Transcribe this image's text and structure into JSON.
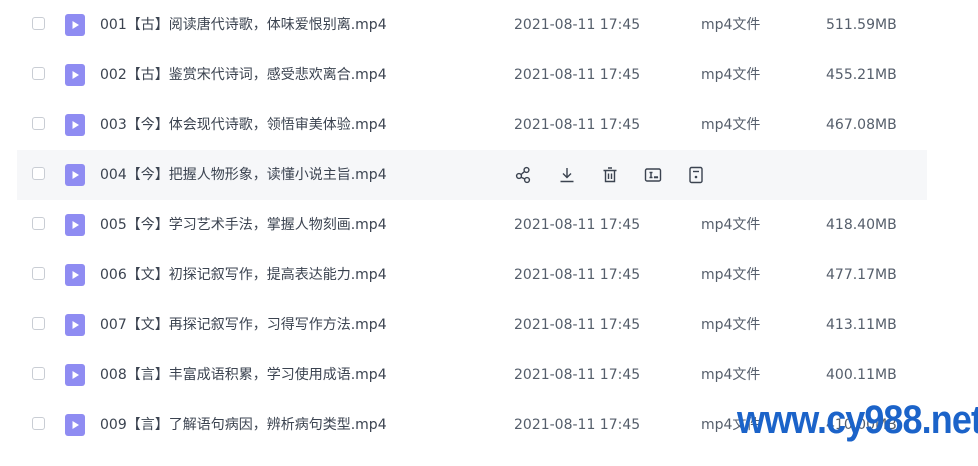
{
  "files": [
    {
      "name": "001【古】阅读唐代诗歌，体味爱恨别离.mp4",
      "date": "2021-08-11 17:45",
      "type": "mp4文件",
      "size": "511.59MB"
    },
    {
      "name": "002【古】鉴赏宋代诗词，感受悲欢离合.mp4",
      "date": "2021-08-11 17:45",
      "type": "mp4文件",
      "size": "455.21MB"
    },
    {
      "name": "003【今】体会现代诗歌，领悟审美体验.mp4",
      "date": "2021-08-11 17:45",
      "type": "mp4文件",
      "size": "467.08MB"
    },
    {
      "name": "004【今】把握人物形象，读懂小说主旨.mp4"
    },
    {
      "name": "005【今】学习艺术手法，掌握人物刻画.mp4",
      "date": "2021-08-11 17:45",
      "type": "mp4文件",
      "size": "418.40MB"
    },
    {
      "name": "006【文】初探记叙写作，提高表达能力.mp4",
      "date": "2021-08-11 17:45",
      "type": "mp4文件",
      "size": "477.17MB"
    },
    {
      "name": "007【文】再探记叙写作，习得写作方法.mp4",
      "date": "2021-08-11 17:45",
      "type": "mp4文件",
      "size": "413.11MB"
    },
    {
      "name": "008【言】丰富成语积累，学习使用成语.mp4",
      "date": "2021-08-11 17:45",
      "type": "mp4文件",
      "size": "400.11MB"
    },
    {
      "name": "009【言】了解语句病因，辨析病句类型.mp4",
      "date": "2021-08-11 17:45",
      "type": "mp4文件",
      "size": "410.00MB"
    }
  ],
  "row_actions": [
    "share-icon",
    "download-icon",
    "delete-icon",
    "rename-icon",
    "details-icon"
  ],
  "colors": {
    "file_icon": "#8f8cf2",
    "watermark": "#1b63c9",
    "hover_row": "#f6f7f9"
  },
  "watermark": "www.cy988.net"
}
